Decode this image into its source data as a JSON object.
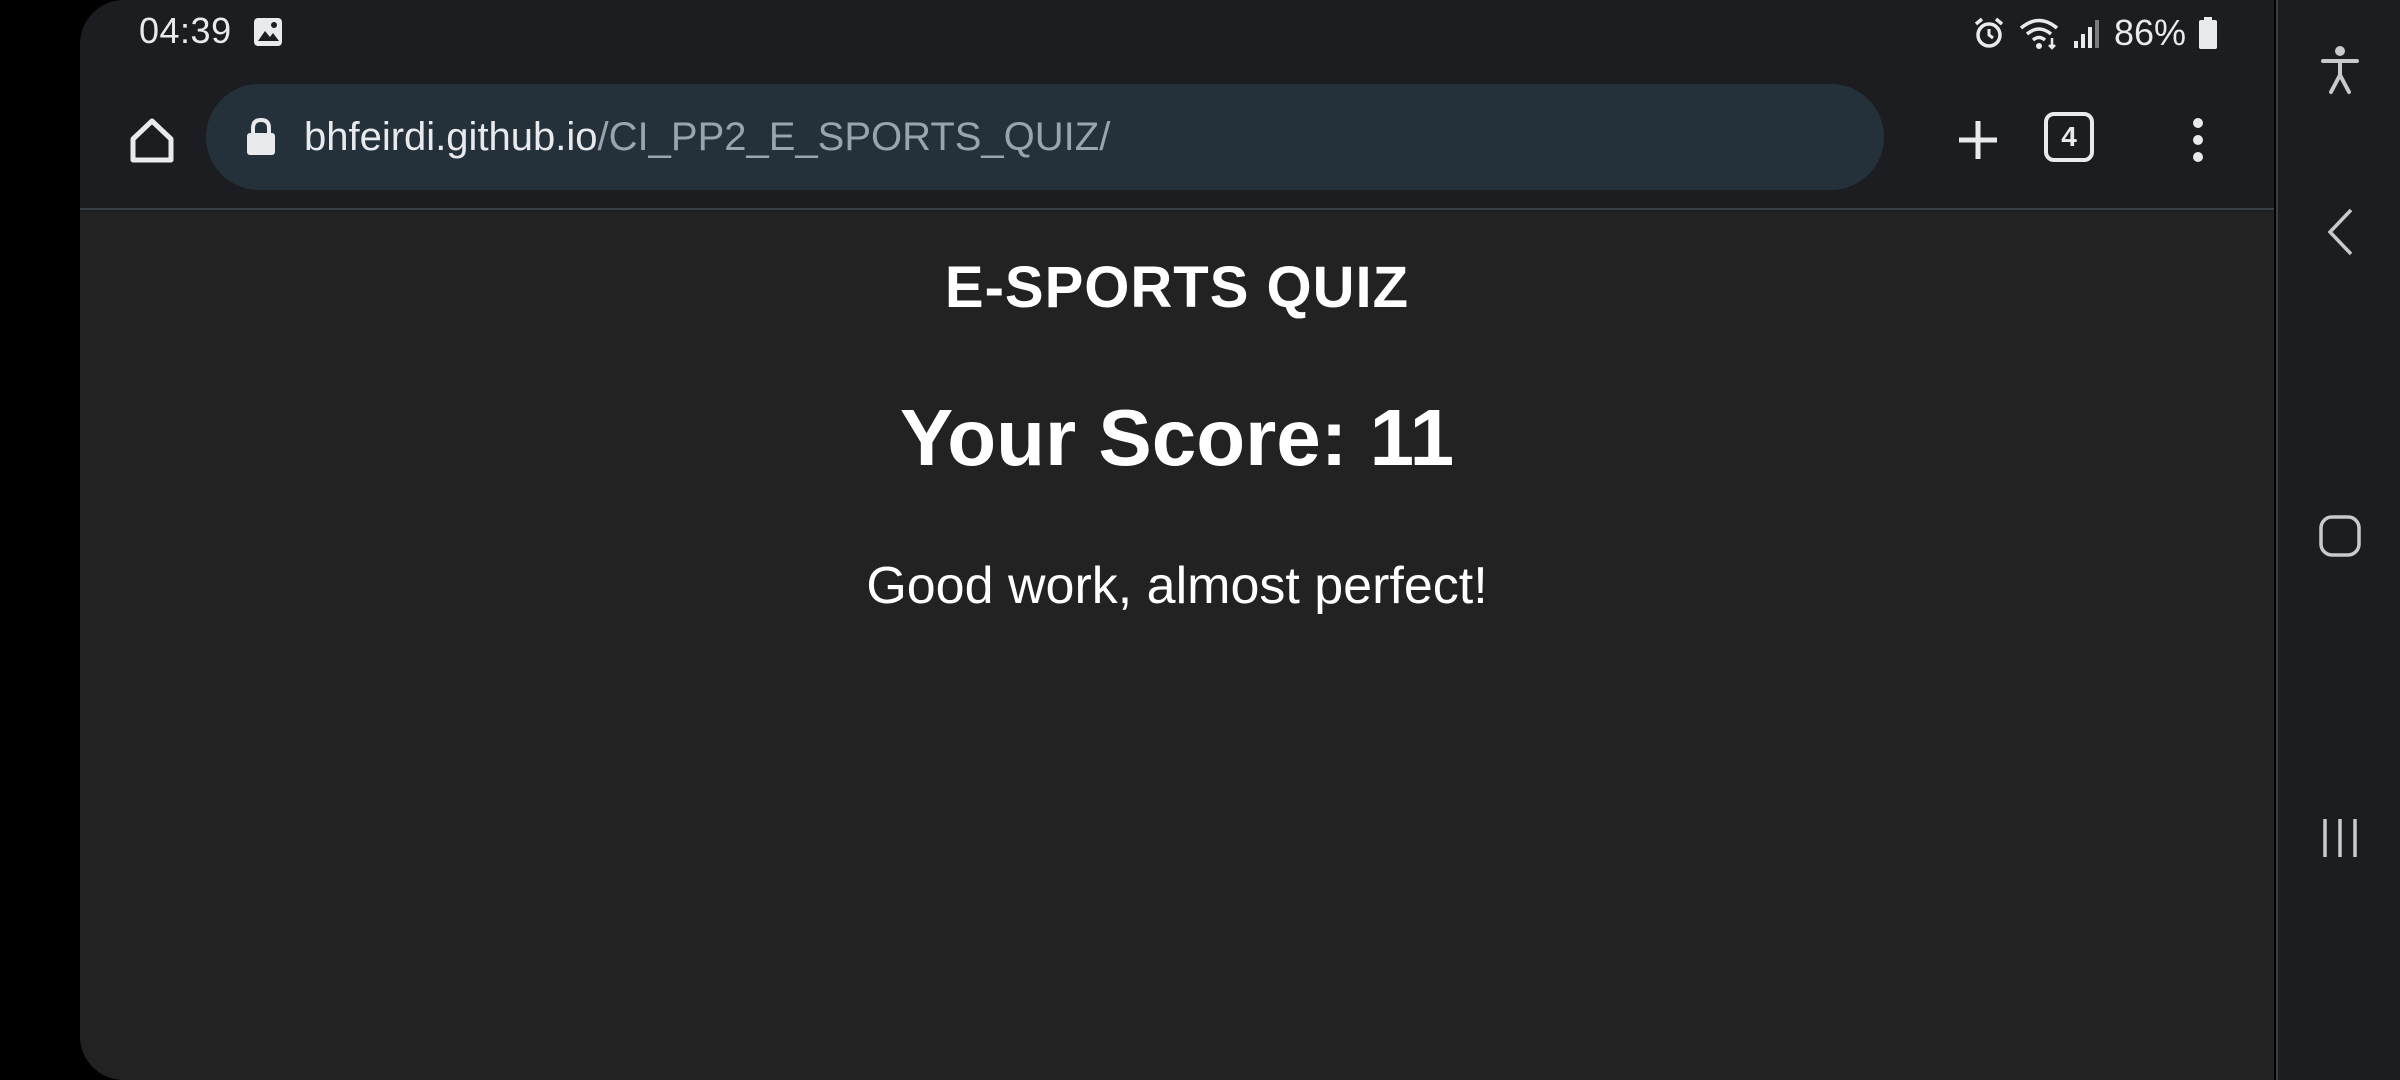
{
  "status_bar": {
    "time": "04:39",
    "battery": "86%",
    "icons": [
      "photo-icon",
      "alarm-icon",
      "wifi-icon",
      "signal-icon",
      "battery-icon"
    ]
  },
  "browser": {
    "url_host": "bhfeirdi.github.io",
    "url_path": "/CI_PP2_E_SPORTS_QUIZ/",
    "tab_count": "4"
  },
  "page": {
    "title": "E-SPORTS QUIZ",
    "score_text": "Your Score: 11",
    "message": "Good work, almost perfect!"
  },
  "colors": {
    "page_background": "#222222",
    "toolbar_background": "#1b1d20",
    "url_bar_background": "#25313a",
    "text": "#ffffff"
  }
}
